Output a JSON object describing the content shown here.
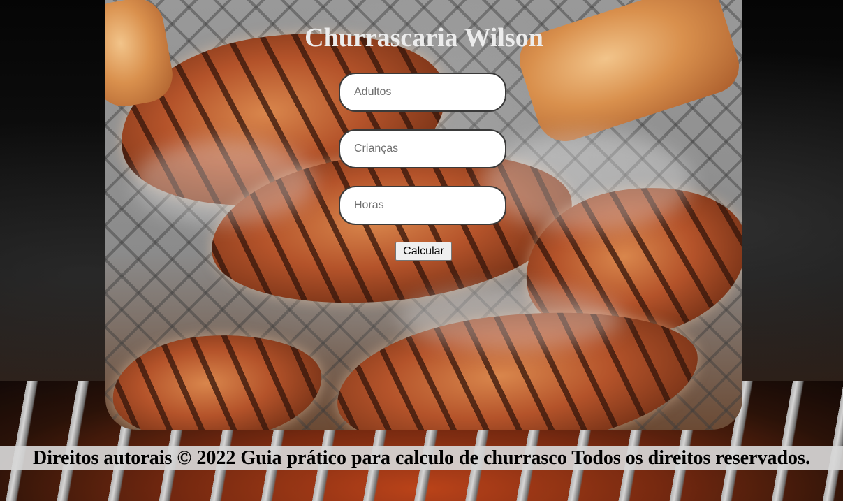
{
  "page": {
    "title": "Churrascaria Wilson"
  },
  "form": {
    "adults_placeholder": "Adultos",
    "children_placeholder": "Crianças",
    "hours_placeholder": "Horas",
    "calculate_label": "Calcular"
  },
  "footer": {
    "text": "Direitos autorais © 2022 Guia prático para calculo de churrasco Todos os direitos reservados."
  }
}
